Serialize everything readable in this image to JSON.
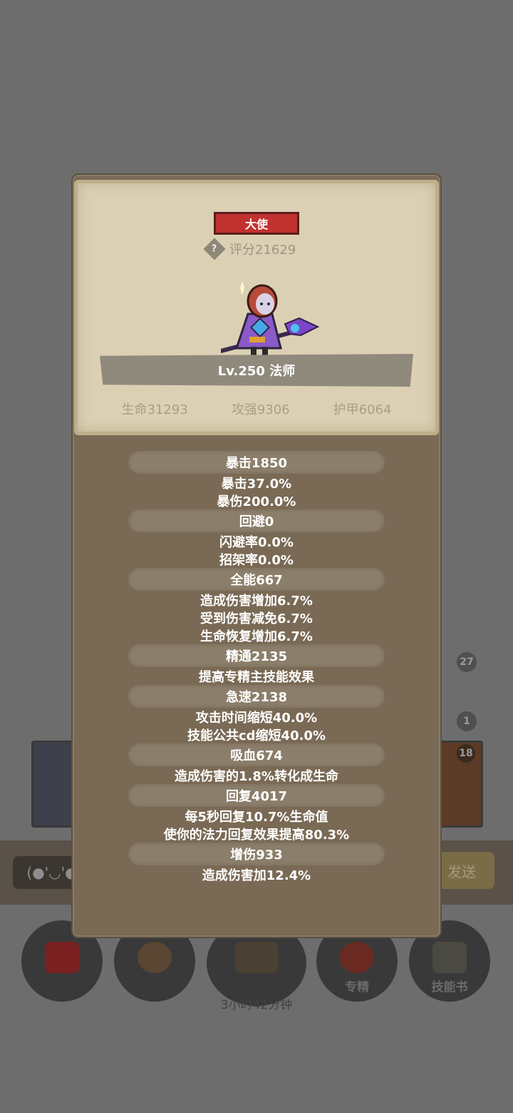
{
  "background": {
    "badges": [
      "27",
      "1",
      "18"
    ],
    "chat_emote": "(●'◡'●",
    "send_label": "发送",
    "bottom_nav": [
      {
        "icon": "potion-icon",
        "label": ""
      },
      {
        "icon": "bread-icon",
        "label": ""
      },
      {
        "icon": "chest-icon",
        "label": "3小时42分钟"
      },
      {
        "icon": "specialization-icon",
        "label": "专精"
      },
      {
        "icon": "skill-book-icon",
        "label": "技能书"
      }
    ]
  },
  "hero": {
    "rank": "大使",
    "score": "评分21629",
    "title": "Lv.250 法师",
    "base_stats": [
      "生命31293",
      "攻强9306",
      "护甲6064"
    ]
  },
  "stats": [
    {
      "header": "暴击1850",
      "lines": [
        "暴击37.0%",
        "暴伤200.0%"
      ]
    },
    {
      "header": "回避0",
      "lines": [
        "闪避率0.0%",
        "招架率0.0%"
      ]
    },
    {
      "header": "全能667",
      "lines": [
        "造成伤害增加6.7%",
        "受到伤害减免6.7%",
        "生命恢复增加6.7%"
      ]
    },
    {
      "header": "精通2135",
      "lines": [
        "提高专精主技能效果"
      ]
    },
    {
      "header": "急速2138",
      "lines": [
        "攻击时间缩短40.0%",
        "技能公共cd缩短40.0%"
      ]
    },
    {
      "header": "吸血674",
      "lines": [
        "造成伤害的1.8%转化成生命"
      ]
    },
    {
      "header": "回复4017",
      "lines": [
        "每5秒回复10.7%生命值",
        "使你的法力回复效果提高80.3%"
      ]
    },
    {
      "header": "增伤933",
      "lines": [
        "造成伤害加12.4%"
      ]
    }
  ],
  "colors": {
    "rank_badge": "#c1312f",
    "panel": "#7a6a55",
    "parchment": "#dcd0b4",
    "stat_header": "#8b7e6a"
  }
}
